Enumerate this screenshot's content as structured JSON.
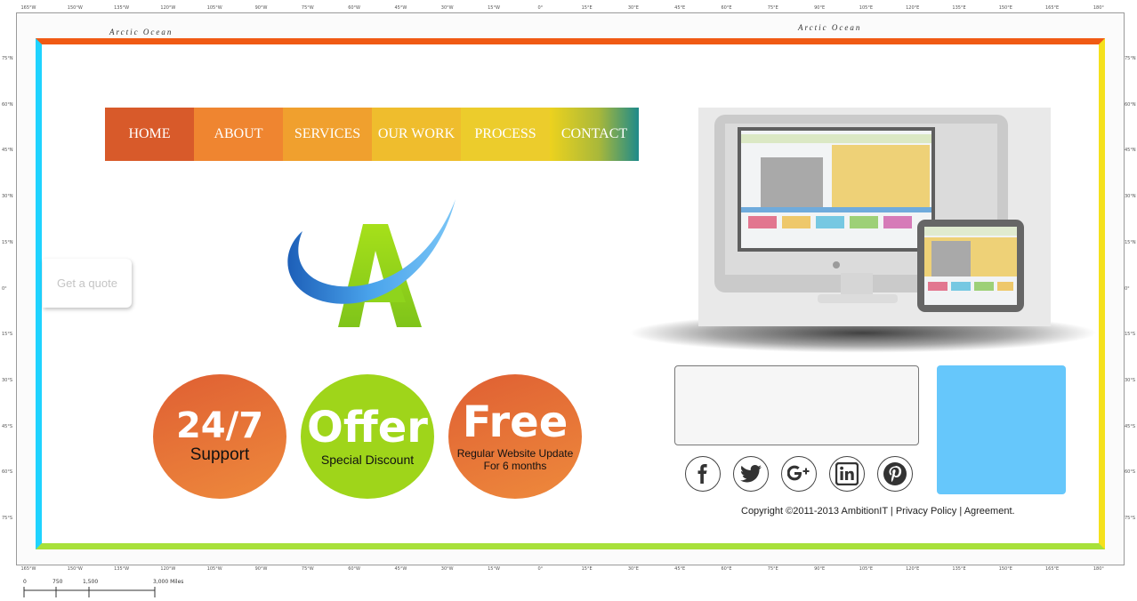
{
  "map": {
    "longitudes": [
      "165°W",
      "150°W",
      "135°W",
      "120°W",
      "105°W",
      "90°W",
      "75°W",
      "60°W",
      "45°W",
      "30°W",
      "15°W",
      "0°",
      "15°E",
      "30°E",
      "45°E",
      "60°E",
      "75°E",
      "90°E",
      "105°E",
      "120°E",
      "135°E",
      "150°E",
      "165°E",
      "180°"
    ],
    "latitudes": [
      "75°N",
      "60°N",
      "45°N",
      "30°N",
      "15°N",
      "0°",
      "15°S",
      "30°S",
      "45°S",
      "60°S",
      "75°S"
    ],
    "ocean_label_left": "Arctic Ocean",
    "ocean_label_right": "Arctic Ocean",
    "scale": {
      "ticks": [
        "0",
        "750",
        "1,500",
        "3,000 Miles"
      ]
    }
  },
  "nav": {
    "items": [
      {
        "label": "HOME",
        "color": "#d85a2a"
      },
      {
        "label": "ABOUT",
        "color": "#ef8530"
      },
      {
        "label": "SERVICES",
        "color": "#f0a02e"
      },
      {
        "label": "OUR WORK",
        "color": "#efbd2d"
      },
      {
        "label": "PROCESS",
        "color": "#eccc2c"
      },
      {
        "label": "CONTACT",
        "color": "#e9d223"
      }
    ]
  },
  "quote_button": {
    "label": "Get a quote"
  },
  "badges": [
    {
      "big": "24/7",
      "small": "Support"
    },
    {
      "big": "Offer",
      "small": "Special Discount"
    },
    {
      "big": "Free",
      "small": "Regular Website Update",
      "small2": "For 6 months"
    }
  ],
  "social": [
    "facebook-icon",
    "twitter-icon",
    "google-plus-icon",
    "linkedin-icon",
    "pinterest-icon"
  ],
  "footer": {
    "copyright": "Copyright ©2011-2013 AmbitionIT",
    "sep": " | ",
    "privacy": "Privacy Policy",
    "agreement": "Agreement."
  },
  "colors": {
    "border_top": "#f05a14",
    "border_left": "#1fd3ff",
    "border_right": "#f5e11c",
    "border_bottom": "#a8e13a",
    "side_box": "#66c7fb"
  }
}
